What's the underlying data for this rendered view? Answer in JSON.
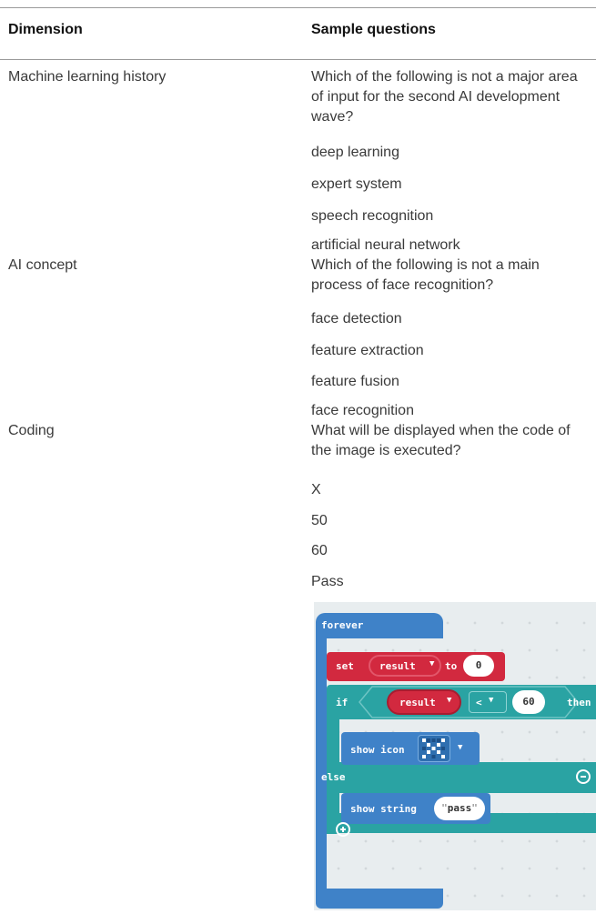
{
  "table": {
    "headers": {
      "dimension": "Dimension",
      "sample_questions": "Sample questions"
    },
    "rows": [
      {
        "dimension": "Machine learning history",
        "question": "Which of the following is not a major area of input for the second AI development wave?",
        "options": [
          "deep learning",
          "expert system",
          "speech recognition",
          "artificial neural network"
        ]
      },
      {
        "dimension": "AI concept",
        "question": "Which of the following is not a main process of face recognition?",
        "options": [
          "face detection",
          "feature extraction",
          "feature fusion",
          "face recognition"
        ]
      },
      {
        "dimension": "Coding",
        "question": "What will be displayed when the code of the image is executed?",
        "options": [
          "X",
          "50",
          "60",
          "Pass"
        ]
      }
    ]
  },
  "code_image": {
    "forever": "forever",
    "set": "set",
    "variable": "result",
    "to": "to",
    "initial_value": "0",
    "if": "if",
    "operator": "<",
    "compare_value": "60",
    "then": "then",
    "show_icon": "show icon",
    "else": "else",
    "show_string": "show string",
    "string_value": "pass",
    "colors": {
      "loop": "#3f82c8",
      "variable": "#d2293f",
      "logic": "#2aa3a3"
    }
  }
}
